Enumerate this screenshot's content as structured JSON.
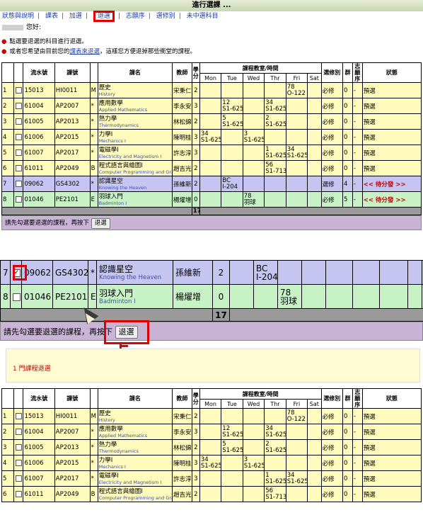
{
  "title": "進行選課 ...",
  "nav": {
    "items": [
      "狀態與說明",
      "課表",
      "加選",
      "退選",
      "志願序",
      "選修別",
      "未中選科目"
    ],
    "active": "退選"
  },
  "greeting": "您好:",
  "notes": {
    "line1": "點選要退選的科目進行退選。",
    "line2_pre": "或者您希望由目前您的",
    "line2_link": "課表來退選",
    "line2_post": "，這樣您方便退掉那些衝堂的課程。"
  },
  "table": {
    "headers": {
      "serial": "流水號",
      "code": "課號",
      "name": "課名",
      "teacher": "教師",
      "credits": "學分",
      "room_time": "課程教室/時間",
      "days": [
        "Mon",
        "Tue",
        "Wed",
        "Thr",
        "Fri",
        "Sat"
      ],
      "elective": "選修別",
      "group": "群",
      "wish": "志願序",
      "status": "狀態"
    },
    "rows": [
      {
        "idx": "1",
        "serial": "15013",
        "code": "HI0011",
        "cat": "M",
        "cn": "歷史",
        "en": "History",
        "teacher": "宋秉仁",
        "credits": "2",
        "days": [
          "",
          "",
          "",
          "",
          "78\nO-122",
          ""
        ],
        "elective": "必修",
        "group": "0",
        "wish": "-",
        "status": "預選"
      },
      {
        "idx": "2",
        "serial": "61004",
        "code": "AP2007",
        "cat": "*",
        "cn": "應用數學",
        "en": "Applied Mathematics",
        "teacher": "李永安",
        "credits": "3",
        "days": [
          "",
          "12\nS1-625",
          "",
          "34\nS1-625",
          "",
          ""
        ],
        "elective": "必修",
        "group": "0",
        "wish": "-",
        "status": "預選"
      },
      {
        "idx": "3",
        "serial": "61005",
        "code": "AP2013",
        "cat": "*",
        "cn": "熱力學",
        "en": "Thermodynamics",
        "teacher": "林松錦",
        "credits": "2",
        "days": [
          "",
          "5\nS1-625",
          "",
          "2\nS1-625",
          "",
          ""
        ],
        "elective": "必修",
        "group": "0",
        "wish": "-",
        "status": "預選"
      },
      {
        "idx": "4",
        "serial": "61006",
        "code": "AP2015",
        "cat": "*",
        "cn": "力學Ⅰ",
        "en": "Mechanics I",
        "teacher": "陳明桂",
        "credits": "3",
        "days": [
          "34\nS1-625",
          "",
          "3\nS1-625",
          "",
          "",
          ""
        ],
        "elective": "必修",
        "group": "0",
        "wish": "-",
        "status": "預選"
      },
      {
        "idx": "5",
        "serial": "61007",
        "code": "AP2017",
        "cat": "*",
        "cn": "電磁學Ⅰ",
        "en": "Electricity and Magnetism I",
        "teacher": "許志淳",
        "credits": "3",
        "days": [
          "",
          "",
          "",
          "1\nS1-625",
          "34\nS1-625",
          ""
        ],
        "elective": "必修",
        "group": "0",
        "wish": "-",
        "status": "預選"
      },
      {
        "idx": "6",
        "serial": "61011",
        "code": "AP2049",
        "cat": "B",
        "cn": "程式語言與繪圖Ⅰ",
        "en": "Computer Programming and Graphics I",
        "teacher": "趙吉光",
        "credits": "2",
        "days": [
          "",
          "",
          "",
          "56\nS1-713",
          "",
          ""
        ],
        "elective": "必修",
        "group": "0",
        "wish": "-",
        "status": "預選"
      },
      {
        "idx": "7",
        "serial": "09062",
        "code": "GS4302",
        "cat": "*",
        "cn": "認識星空",
        "en": "Knowing the Heaven",
        "teacher": "孫維新",
        "credits": "2",
        "days": [
          "",
          "BC\nI-204",
          "",
          "",
          "",
          ""
        ],
        "elective": "選修",
        "group": "4",
        "wish": "-",
        "status": "<< 待分發 >>"
      },
      {
        "idx": "8",
        "serial": "01046",
        "code": "PE2101",
        "cat": "E",
        "cn": "羽球入門",
        "en": "Badminton I",
        "teacher": "楊燿增",
        "credits": "0",
        "days": [
          "",
          "",
          "78\n羽球",
          "",
          "",
          ""
        ],
        "elective": "必修",
        "group": "5",
        "wish": "-",
        "status": "<< 待分發 >>"
      }
    ],
    "total_credits": "17",
    "footer_text": "請先勾選要退選的課程，再按下",
    "drop_button": "退選"
  },
  "result_message": "1 門課程退選",
  "colors": {
    "accent_red": "#e00000",
    "link_blue": "#1a3ea8",
    "row_default": "#fffbbc",
    "row_purple": "#c6c5f2",
    "row_green": "#c6f2c6",
    "footer_bg": "#c9b3d6"
  }
}
